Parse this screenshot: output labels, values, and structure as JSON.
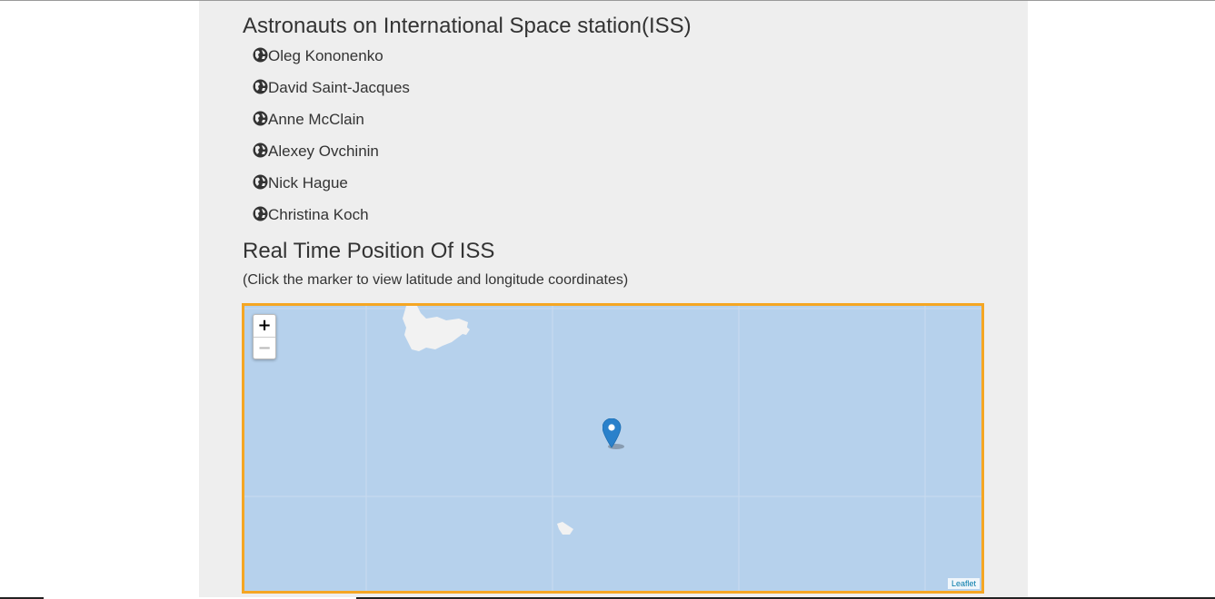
{
  "astronauts_section": {
    "title": "Astronauts on International Space station(ISS)",
    "icon": "globe-icon",
    "astronauts": [
      "Oleg Kononenko",
      "David Saint-Jacques",
      "Anne McClain",
      "Alexey Ovchinin",
      "Nick Hague",
      "Christina Koch"
    ]
  },
  "position_section": {
    "title": "Real Time Position Of ISS",
    "subtitle": "(Click the marker to view latitude and longitude coordinates)"
  },
  "map": {
    "zoom_in_label": "+",
    "zoom_out_label": "−",
    "attribution": "Leaflet",
    "marker_icon": "map-marker-icon",
    "colors": {
      "water": "#b6d1ec",
      "land": "#f2f2f2",
      "border": "#f5a623",
      "marker": "#2a81cb"
    }
  }
}
